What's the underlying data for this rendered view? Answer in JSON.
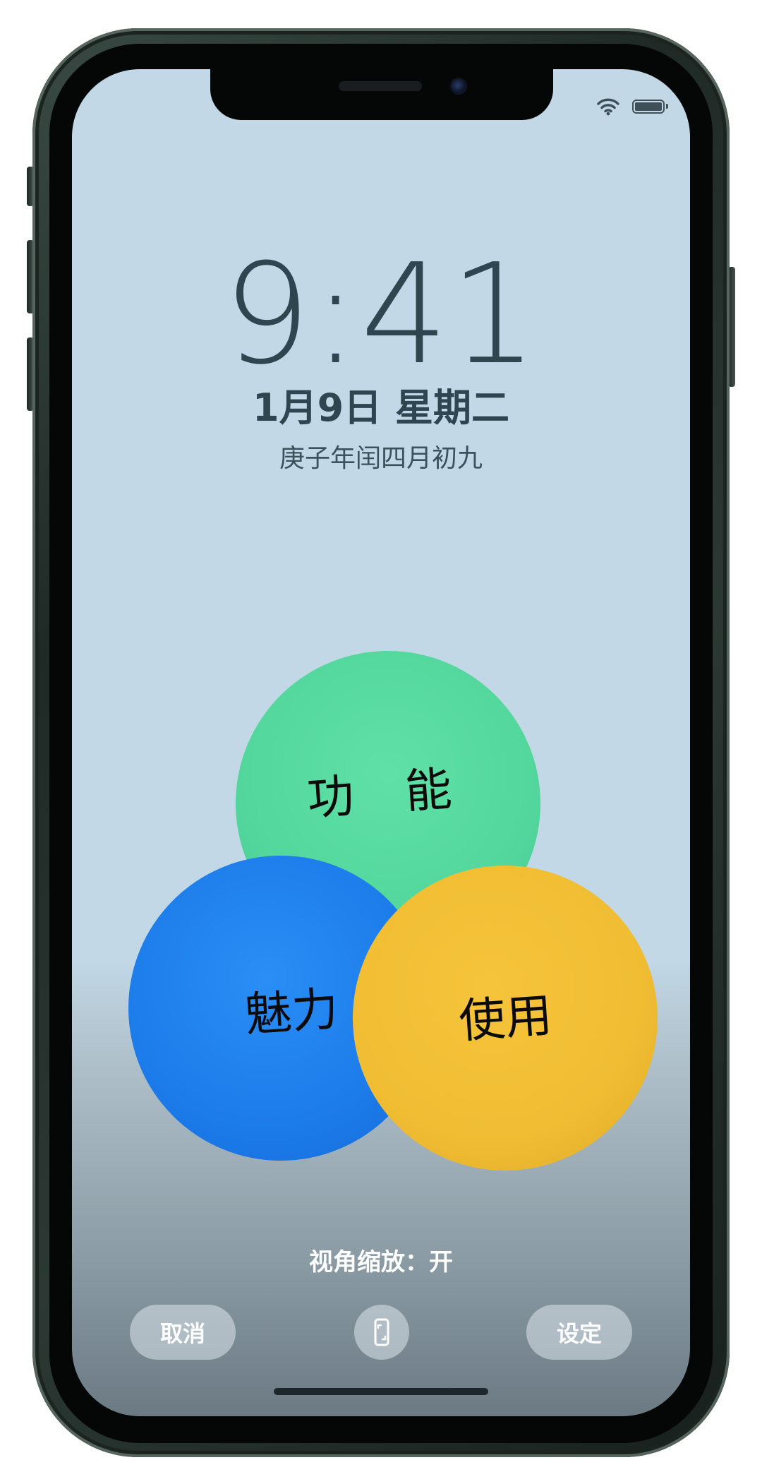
{
  "status_bar": {
    "wifi_icon": "wifi-icon",
    "battery_icon": "battery-icon"
  },
  "lock_screen": {
    "time": "9:41",
    "date": "1月9日 星期二",
    "lunar_date": "庚子年闰四月初九"
  },
  "wallpaper": {
    "balls": [
      {
        "label": "功 能",
        "color": "#53d79d"
      },
      {
        "label": "魅力",
        "color": "#1b7ae8"
      },
      {
        "label": "使用",
        "color": "#f0bd33"
      }
    ]
  },
  "controls": {
    "zoom_label": "视角缩放：开",
    "cancel_label": "取消",
    "set_label": "设定",
    "perspective_icon": "perspective-zoom-icon"
  },
  "colors": {
    "text_dark": "#2f4650",
    "background": "#c2d8e6"
  }
}
